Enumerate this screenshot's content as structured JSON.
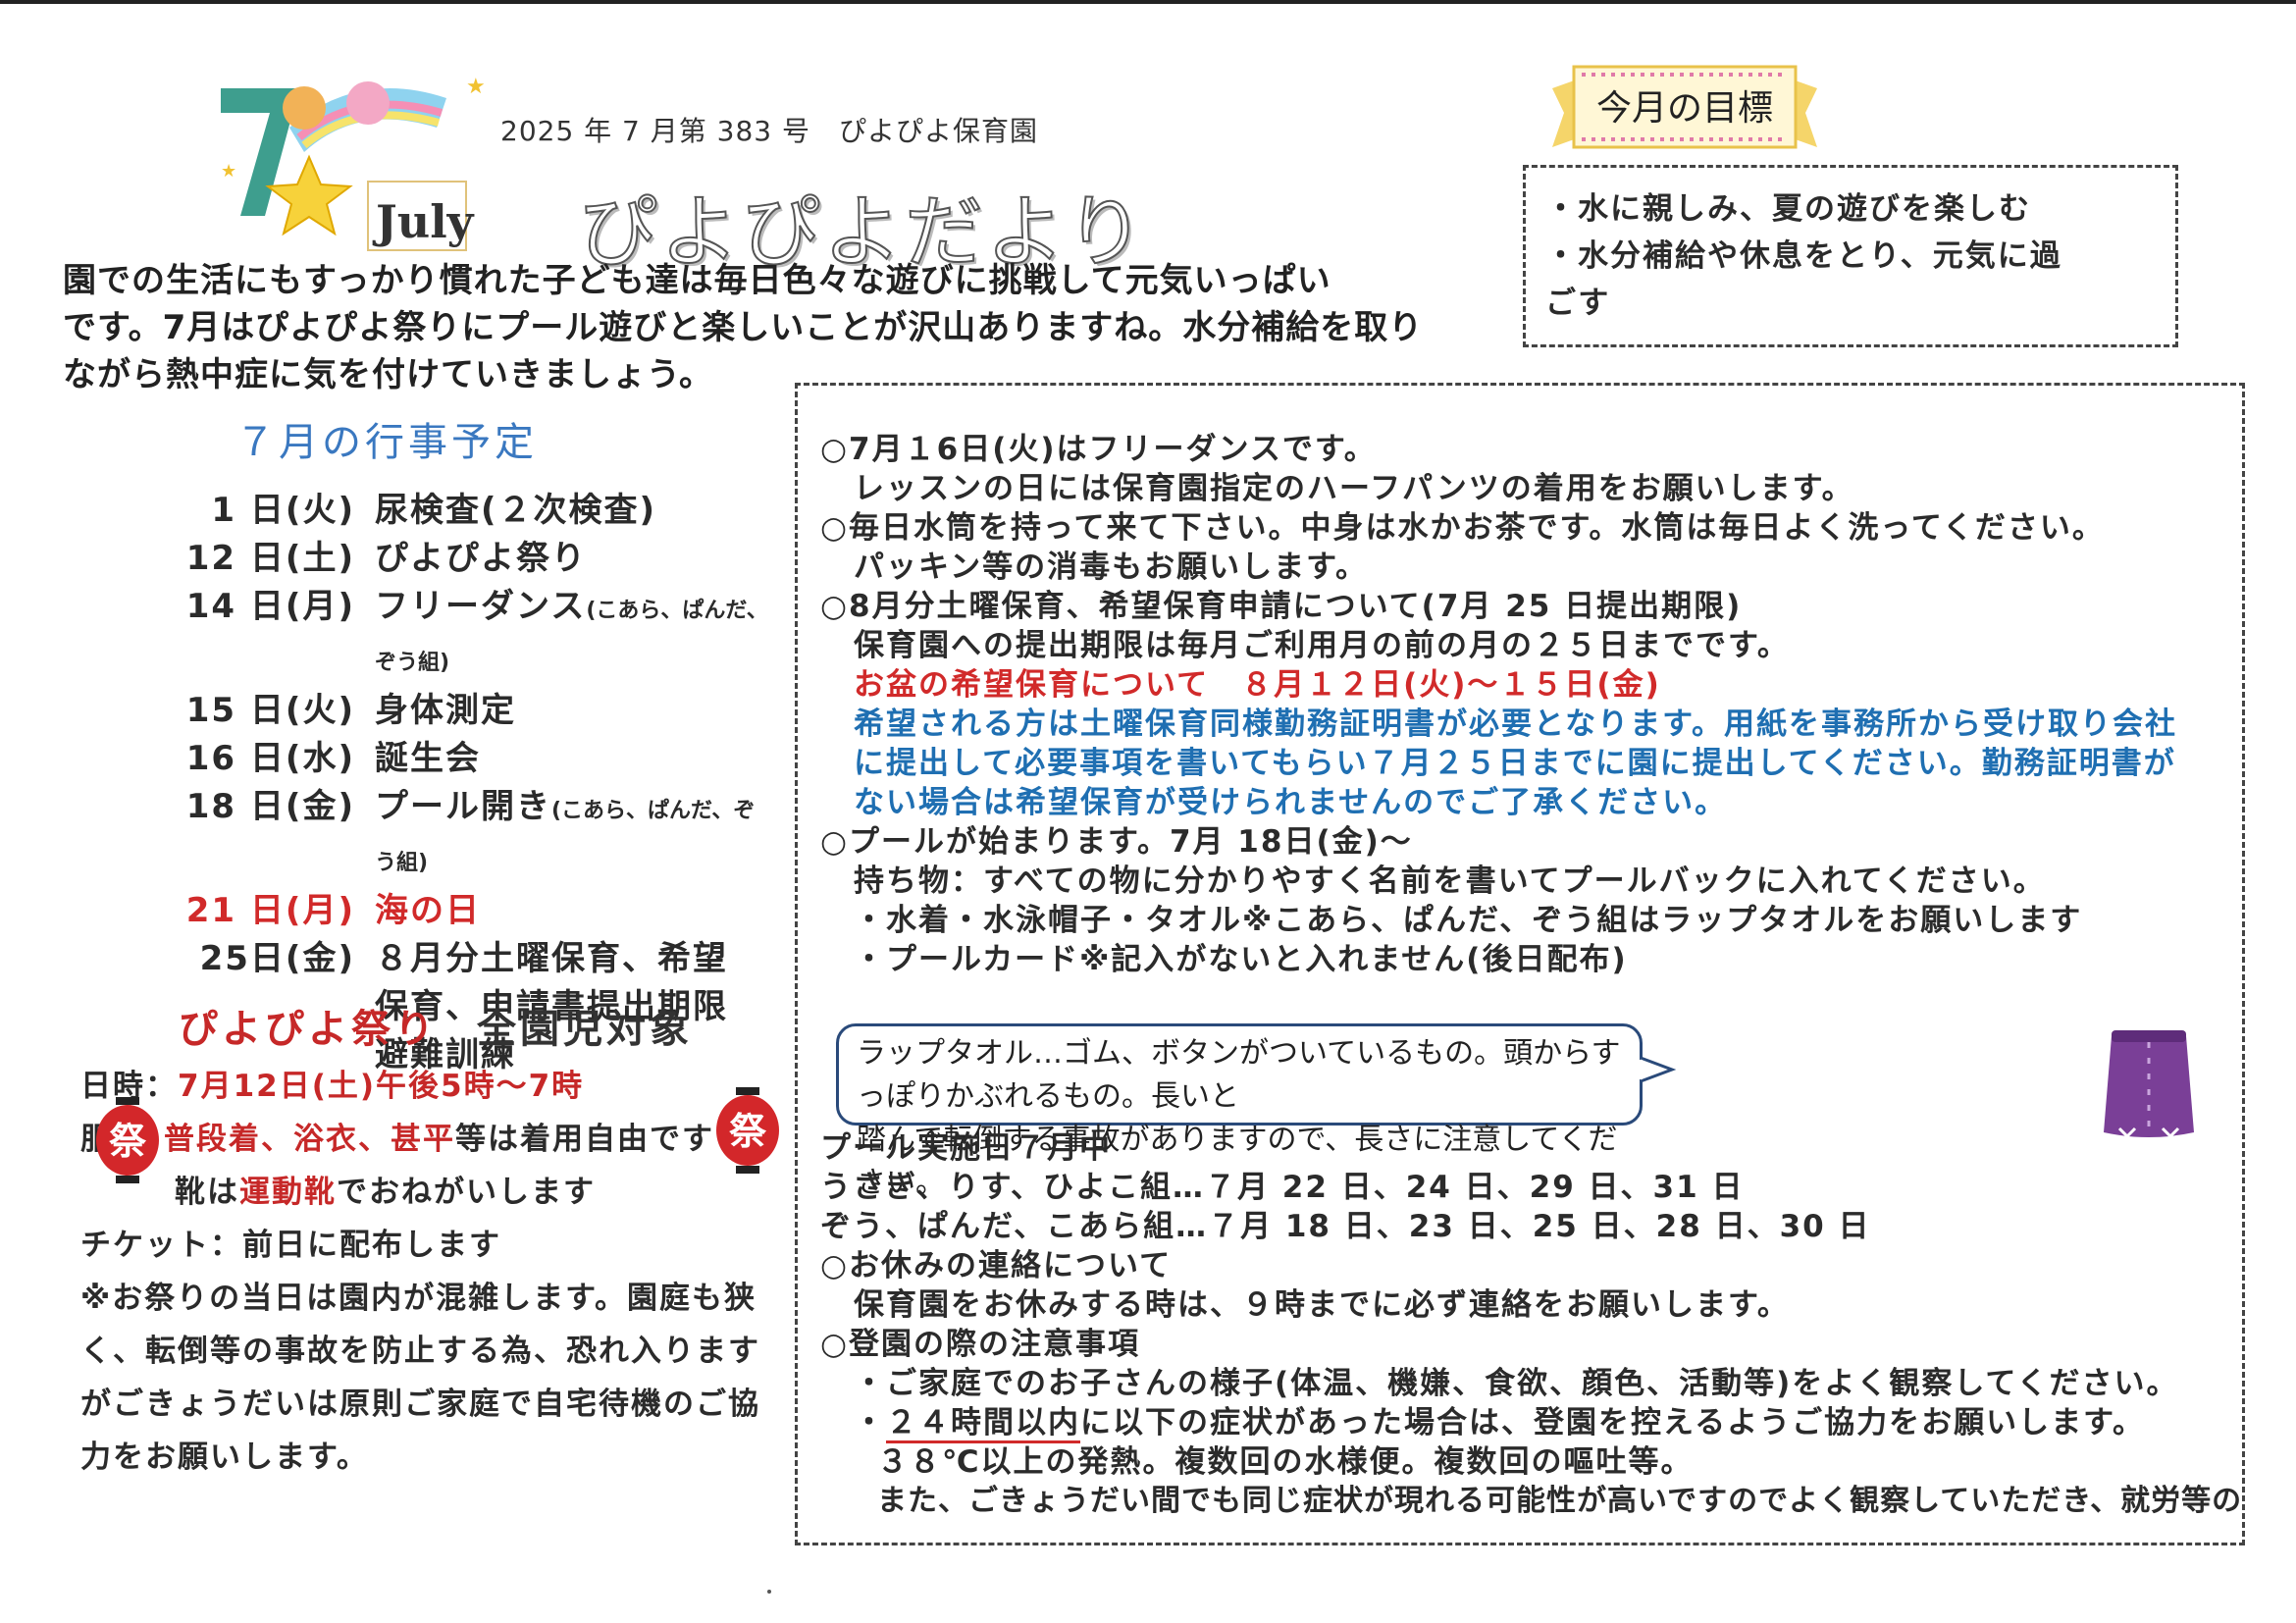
{
  "header": {
    "issue": "2025 年 7 月第 383 号　ぴよぴよ保育園",
    "title": "ぴよぴよだより",
    "month_badge": "July",
    "month_number": "7"
  },
  "intro": [
    "園での生活にもすっかり慣れた子ども達は毎日色々な遊びに挑戦して元気いっぱい",
    "です。7月はぴよぴよ祭りにプール遊びと楽しいことが沢山ありますね。水分補給を取り",
    "ながら熱中症に気を付けていきましょう。"
  ],
  "goals": {
    "badge": "今月の目標",
    "items": [
      "・水に親しみ、夏の遊びを楽しむ",
      "・水分補給や休息をとり、元気に過",
      "ごす"
    ]
  },
  "events": {
    "title": "７月の行事予定",
    "rows": [
      {
        "date": "1 日(火)",
        "desc": "尿検査(２次検査)",
        "note": ""
      },
      {
        "date": "12 日(土)",
        "desc": "ぴよぴよ祭り",
        "note": ""
      },
      {
        "date": "14 日(月)",
        "desc": "フリーダンス",
        "note": "(こあら、ぱんだ、ぞう組)"
      },
      {
        "date": "15 日(火)",
        "desc": "身体測定",
        "note": ""
      },
      {
        "date": "16 日(水)",
        "desc": "誕生会",
        "note": ""
      },
      {
        "date": "18 日(金)",
        "desc": "プール開き",
        "note": "(こあら、ぱんだ、ぞう組)"
      },
      {
        "date": "21 日(月)",
        "desc": "海の日",
        "note": ""
      },
      {
        "date": "25日(金)",
        "desc": "８月分土曜保育、希望",
        "note": ""
      },
      {
        "date": "",
        "desc": "保育、申請書提出期限",
        "note": ""
      },
      {
        "date": "",
        "desc": "避難訓練",
        "note": ""
      }
    ]
  },
  "festival": {
    "title": "ぴよぴよ祭り",
    "target": "全園児対象",
    "lantern": "祭",
    "datetime_label": "日時：",
    "datetime_value": "7月12日(土)午後5時～7時",
    "clothes_label": "服",
    "clothes_red": "普段着、浴衣、甚平",
    "clothes_rest": "等は着用自由です",
    "shoes_pre": "靴は",
    "shoes_red": "運動靴",
    "shoes_post": "でおねがいします",
    "ticket": "チケット：前日に配布します",
    "notes": [
      "※お祭りの当日は園内が混雑します。園庭も狭",
      "く、転倒等の事故を防止する為、恐れ入ります",
      "がごきょうだいは原則ご家庭で自宅待機のご協",
      "力をお願いします。"
    ]
  },
  "notices": {
    "l1": "○7月１6日(火)はフリーダンスです。",
    "l2": "レッスンの日には保育園指定のハーフパンツの着用をお願いします。",
    "l3": "○毎日水筒を持って来て下さい。中身は水かお茶です。水筒は毎日よく洗ってください。",
    "l4": "パッキン等の消毒もお願いします。",
    "l5": "○8月分土曜保育、希望保育申請について(7月 25 日提出期限)",
    "l6": "保育園への提出期限は毎月ご利用月の前の月の２５日までです。",
    "l7": "お盆の希望保育について　８月１２日(火)～１５日(金)",
    "l8": "希望される方は土曜保育同様勤務証明書が必要となります。用紙を事務所から受け取り会社",
    "l9": "に提出して必要事項を書いてもらい７月２５日までに園に提出してください。勤務証明書が",
    "l10": "ない場合は希望保育が受けられませんのでご了承ください。",
    "l11": "○プールが始まります。7月 18日(金)～",
    "l12": "持ち物：すべての物に分かりやすく名前を書いてプールバックに入れてください。",
    "l13": "・水着・水泳帽子・タオル※こあら、ぱんだ、ぞう組はラップタオルをお願いします",
    "l14": "・プールカード※記入がないと入れません(後日配布)"
  },
  "bubble": [
    "ラップタオル…ゴム、ボタンがついているもの。頭からすっぽりかぶれるもの。長いと",
    "踏んで転倒する事故がありますので、長さに注意してください。"
  ],
  "pool": {
    "p1": "プール実施日７月中",
    "p2": "うさぎ、りす、ひよこ組…７月 22 日、24 日、29 日、31 日",
    "p3": "ぞう、ぱんだ、こあら組…７月 18 日、23 日、25 日、28 日、30 日",
    "p4": "○お休みの連絡について",
    "p5": "保育園をお休みする時は、９時までに必ず連絡をお願いします。",
    "p6": "○登園の際の注意事項",
    "p7": "・ご家庭でのお子さんの様子(体温、機嫌、食欲、顔色、活動等)をよく観察してください。",
    "p8a": "・",
    "p8b": "２４時間以内",
    "p8c": "に以下の症状があった場合は、登園を控えるようご協力をお願いします。",
    "p9": "３８℃以上の発熱。複数回の水様便。複数回の嘔吐等。",
    "p10": "また、ごきょうだい間でも同じ症状が現れる可能性が高いですのでよく観察していただき、就労等の"
  },
  "colors": {
    "red": "#d12a2a",
    "blue": "#1f6fb2",
    "title_blue": "#3a78c0"
  }
}
